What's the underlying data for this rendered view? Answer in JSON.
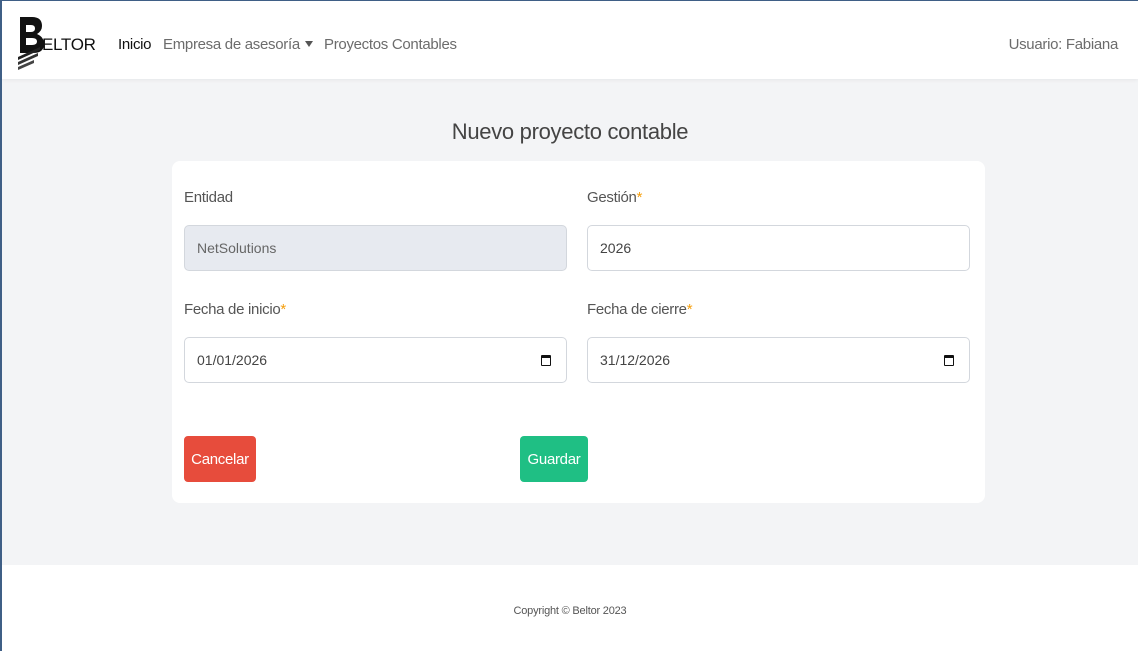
{
  "navbar": {
    "brand": "ELTOR",
    "links": {
      "inicio": "Inicio",
      "empresa": "Empresa de asesoría",
      "proyectos": "Proyectos Contables"
    },
    "user": "Usuario: Fabiana"
  },
  "page": {
    "title": "Nuevo proyecto contable"
  },
  "form": {
    "entidad": {
      "label": "Entidad",
      "value": "NetSolutions"
    },
    "gestion": {
      "label": "Gestión",
      "required": "*",
      "value": "2026"
    },
    "fecha_inicio": {
      "label": "Fecha de inicio",
      "required": "*",
      "value": "01/01/2026"
    },
    "fecha_cierre": {
      "label": "Fecha de cierre",
      "required": "*",
      "value": "31/12/2026"
    }
  },
  "buttons": {
    "cancel": "Cancelar",
    "save": "Guardar"
  },
  "footer": {
    "copyright": "Copyright © Beltor 2023"
  },
  "colors": {
    "cancel": "#e74c3c",
    "save": "#1fbf84",
    "required": "#f59e0b"
  },
  "icons": {
    "logo": "beltor-b-logo",
    "dropdown": "caret-down-icon",
    "calendar": "calendar-icon"
  }
}
